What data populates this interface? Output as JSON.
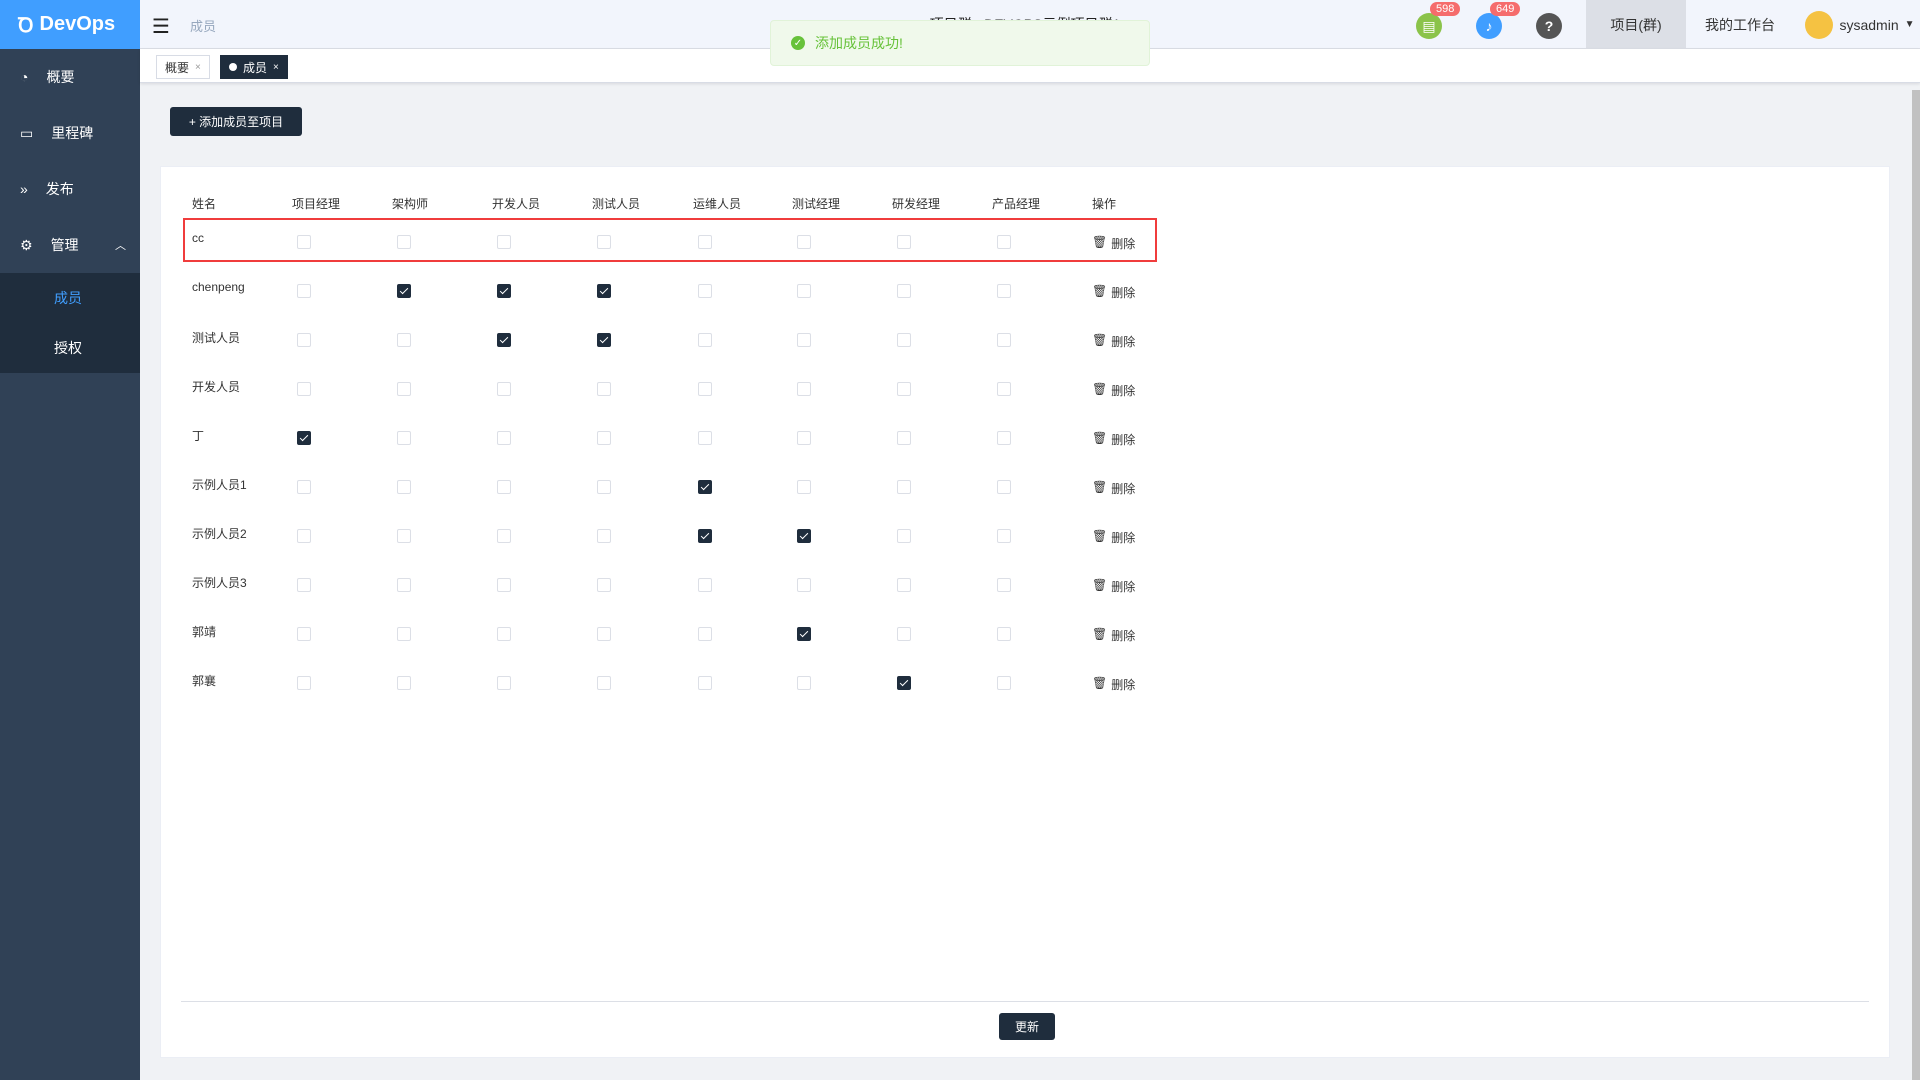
{
  "app": {
    "name": "DevOps"
  },
  "sidebar": {
    "items": [
      {
        "label": "概要",
        "icon": "dashboard-icon"
      },
      {
        "label": "里程碑",
        "icon": "folder-icon"
      },
      {
        "label": "发布",
        "icon": "forward-icon"
      },
      {
        "label": "管理",
        "icon": "gear-icon"
      }
    ],
    "sub": [
      {
        "label": "成员",
        "active": true
      },
      {
        "label": "授权"
      }
    ]
  },
  "header": {
    "breadcrumb": "成员",
    "title": "◆ 项目群 - DEVOPS示例项目群1",
    "badge_tasks": "598",
    "badge_notify": "649",
    "nav1": "项目(群)",
    "nav2": "我的工作台",
    "user": "sysadmin"
  },
  "tabs": [
    {
      "label": "概要"
    },
    {
      "label": "成员",
      "active": true
    }
  ],
  "toast": {
    "message": "添加成员成功!",
    "type": "success"
  },
  "toolbar": {
    "add_label": "+ 添加成员至项目",
    "update_label": "更新"
  },
  "table": {
    "columns": [
      "姓名",
      "项目经理",
      "架构师",
      "开发人员",
      "测试人员",
      "运维人员",
      "测试经理",
      "研发经理",
      "产品经理",
      "操作"
    ],
    "delete_label": "删除",
    "rows": [
      {
        "name": "cc",
        "roles": [
          0,
          0,
          0,
          0,
          0,
          0,
          0,
          0
        ],
        "highlighted": true
      },
      {
        "name": "chenpeng",
        "roles": [
          0,
          1,
          1,
          1,
          0,
          0,
          0,
          0
        ]
      },
      {
        "name": "测试人员",
        "roles": [
          0,
          0,
          1,
          1,
          0,
          0,
          0,
          0
        ]
      },
      {
        "name": "开发人员",
        "roles": [
          0,
          0,
          0,
          0,
          0,
          0,
          0,
          0
        ]
      },
      {
        "name": "丁",
        "roles": [
          1,
          0,
          0,
          0,
          0,
          0,
          0,
          0
        ]
      },
      {
        "name": "示例人员1",
        "roles": [
          0,
          0,
          0,
          0,
          1,
          0,
          0,
          0
        ]
      },
      {
        "name": "示例人员2",
        "roles": [
          0,
          0,
          0,
          0,
          1,
          1,
          0,
          0
        ]
      },
      {
        "name": "示例人员3",
        "roles": [
          0,
          0,
          0,
          0,
          0,
          0,
          0,
          0
        ]
      },
      {
        "name": "郭靖",
        "roles": [
          0,
          0,
          0,
          0,
          0,
          1,
          0,
          0
        ]
      },
      {
        "name": "郭襄",
        "roles": [
          0,
          0,
          0,
          0,
          0,
          0,
          1,
          0
        ]
      }
    ]
  },
  "colors": {
    "primary": "#1f2d3d",
    "sidebar": "#304156",
    "logo": "#409eff",
    "success": "#67c23a",
    "highlight": "#f03c3c"
  }
}
